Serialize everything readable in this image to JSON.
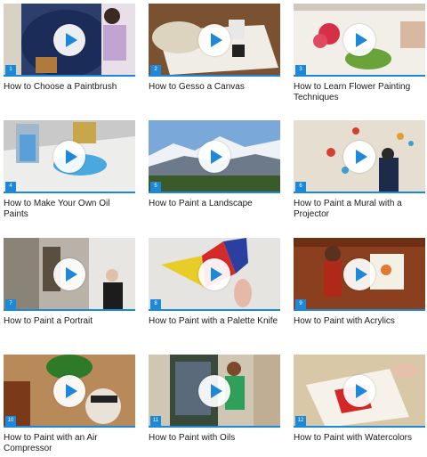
{
  "colors": {
    "accent": "#1e88d8",
    "title_text": "#1a1a1a"
  },
  "videos": [
    {
      "number": "1",
      "title": "How to Choose a Paintbrush",
      "icon": "play-icon"
    },
    {
      "number": "2",
      "title": "How to Gesso a Canvas",
      "icon": "play-icon"
    },
    {
      "number": "3",
      "title": "How to Learn Flower Painting Techniques",
      "icon": "play-icon"
    },
    {
      "number": "4",
      "title": "How to Make Your Own Oil Paints",
      "icon": "play-icon"
    },
    {
      "number": "5",
      "title": "How to Paint a Landscape",
      "icon": "play-icon"
    },
    {
      "number": "6",
      "title": "How to Paint a Mural with a Projector",
      "icon": "play-icon"
    },
    {
      "number": "7",
      "title": "How to Paint a Portrait",
      "icon": "play-icon"
    },
    {
      "number": "8",
      "title": "How to Paint with a Palette Knife",
      "icon": "play-icon"
    },
    {
      "number": "9",
      "title": "How to Paint with Acrylics",
      "icon": "play-icon"
    },
    {
      "number": "10",
      "title": "How to Paint with an Air Compressor",
      "icon": "play-icon"
    },
    {
      "number": "11",
      "title": "How to Paint with Oils",
      "icon": "play-icon"
    },
    {
      "number": "12",
      "title": "How to Paint with Watercolors",
      "icon": "play-icon"
    }
  ]
}
